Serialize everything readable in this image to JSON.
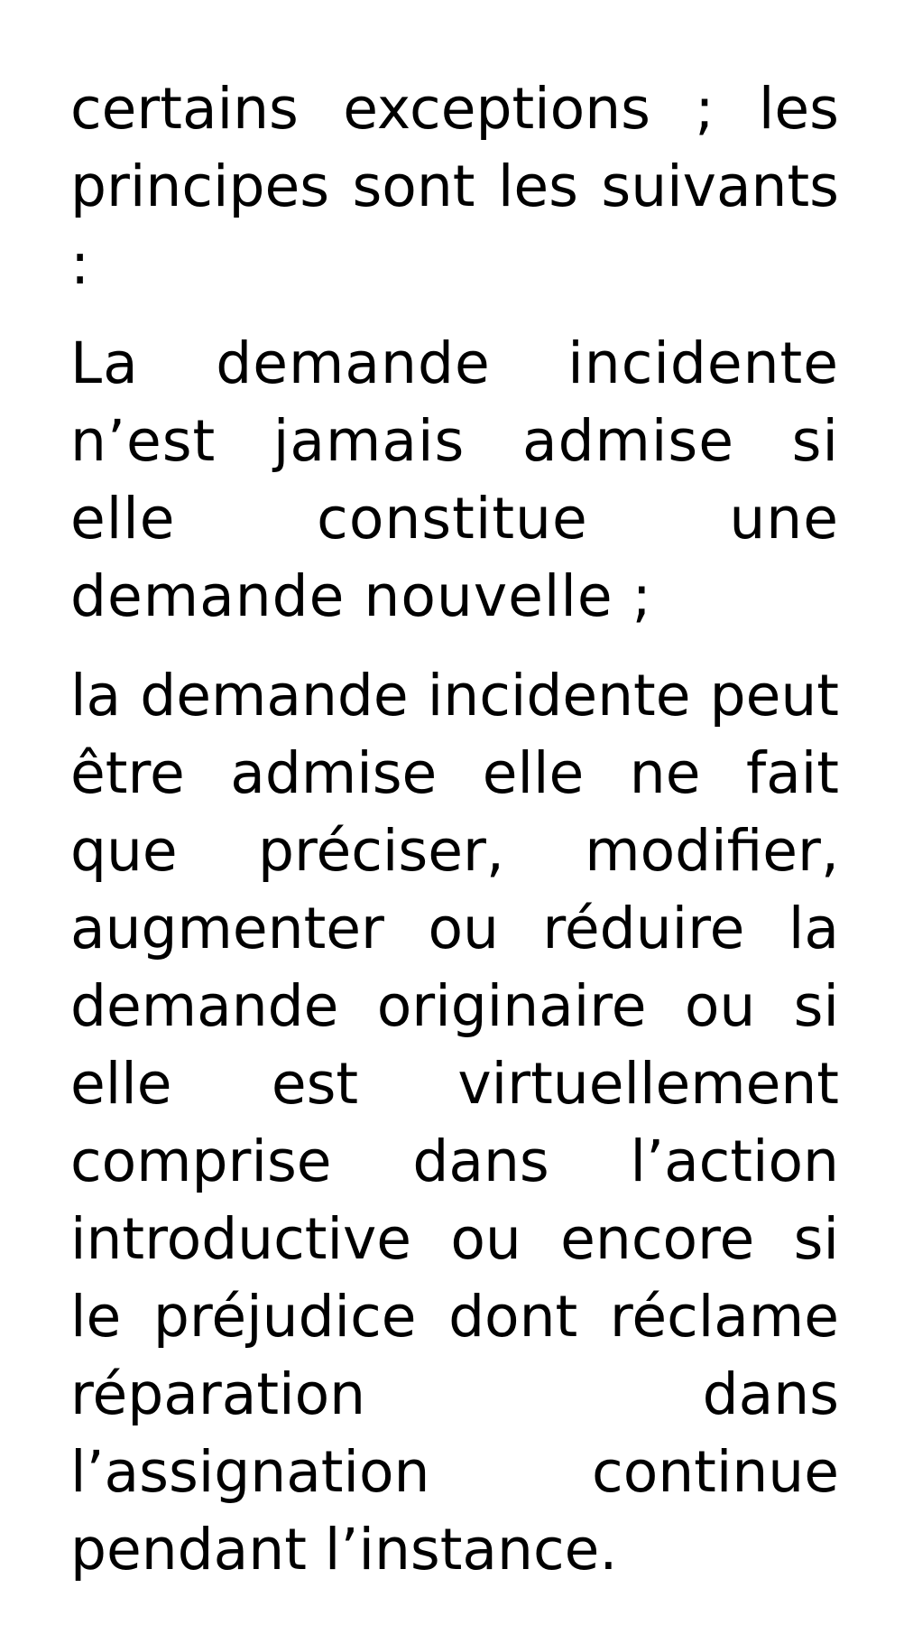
{
  "paragraphs": [
    "certains exceptions ; les principes sont les suivants :",
    "La demande incidente n’est jamais admise si elle constitue une demande nouvelle ;",
    "la demande incidente peut être admise elle ne fait que préciser, modifier, augmenter ou réduire la demande originaire ou si elle est virtuellement comprise dans l’action introductive ou encore si le préjudice dont réclame réparation dans l’assignation continue pendant l’instance."
  ]
}
